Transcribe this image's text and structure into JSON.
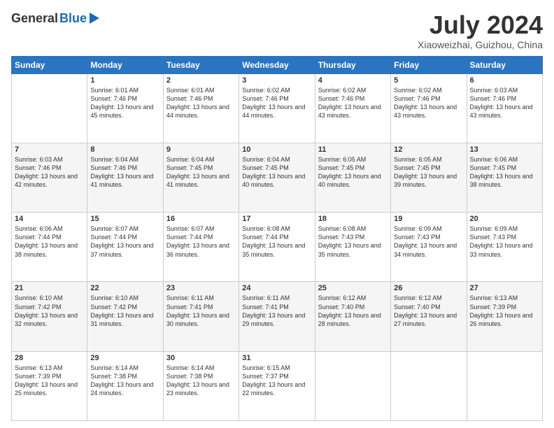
{
  "header": {
    "logo_general": "General",
    "logo_blue": "Blue",
    "month_title": "July 2024",
    "location": "Xiaoweizhai, Guizhou, China"
  },
  "calendar": {
    "headers": [
      "Sunday",
      "Monday",
      "Tuesday",
      "Wednesday",
      "Thursday",
      "Friday",
      "Saturday"
    ],
    "weeks": [
      [
        {
          "day": "",
          "sunrise": "",
          "sunset": "",
          "daylight": ""
        },
        {
          "day": "1",
          "sunrise": "Sunrise: 6:01 AM",
          "sunset": "Sunset: 7:46 PM",
          "daylight": "Daylight: 13 hours and 45 minutes."
        },
        {
          "day": "2",
          "sunrise": "Sunrise: 6:01 AM",
          "sunset": "Sunset: 7:46 PM",
          "daylight": "Daylight: 13 hours and 44 minutes."
        },
        {
          "day": "3",
          "sunrise": "Sunrise: 6:02 AM",
          "sunset": "Sunset: 7:46 PM",
          "daylight": "Daylight: 13 hours and 44 minutes."
        },
        {
          "day": "4",
          "sunrise": "Sunrise: 6:02 AM",
          "sunset": "Sunset: 7:46 PM",
          "daylight": "Daylight: 13 hours and 43 minutes."
        },
        {
          "day": "5",
          "sunrise": "Sunrise: 6:02 AM",
          "sunset": "Sunset: 7:46 PM",
          "daylight": "Daylight: 13 hours and 43 minutes."
        },
        {
          "day": "6",
          "sunrise": "Sunrise: 6:03 AM",
          "sunset": "Sunset: 7:46 PM",
          "daylight": "Daylight: 13 hours and 43 minutes."
        }
      ],
      [
        {
          "day": "7",
          "sunrise": "Sunrise: 6:03 AM",
          "sunset": "Sunset: 7:46 PM",
          "daylight": "Daylight: 13 hours and 42 minutes."
        },
        {
          "day": "8",
          "sunrise": "Sunrise: 6:04 AM",
          "sunset": "Sunset: 7:46 PM",
          "daylight": "Daylight: 13 hours and 41 minutes."
        },
        {
          "day": "9",
          "sunrise": "Sunrise: 6:04 AM",
          "sunset": "Sunset: 7:45 PM",
          "daylight": "Daylight: 13 hours and 41 minutes."
        },
        {
          "day": "10",
          "sunrise": "Sunrise: 6:04 AM",
          "sunset": "Sunset: 7:45 PM",
          "daylight": "Daylight: 13 hours and 40 minutes."
        },
        {
          "day": "11",
          "sunrise": "Sunrise: 6:05 AM",
          "sunset": "Sunset: 7:45 PM",
          "daylight": "Daylight: 13 hours and 40 minutes."
        },
        {
          "day": "12",
          "sunrise": "Sunrise: 6:05 AM",
          "sunset": "Sunset: 7:45 PM",
          "daylight": "Daylight: 13 hours and 39 minutes."
        },
        {
          "day": "13",
          "sunrise": "Sunrise: 6:06 AM",
          "sunset": "Sunset: 7:45 PM",
          "daylight": "Daylight: 13 hours and 38 minutes."
        }
      ],
      [
        {
          "day": "14",
          "sunrise": "Sunrise: 6:06 AM",
          "sunset": "Sunset: 7:44 PM",
          "daylight": "Daylight: 13 hours and 38 minutes."
        },
        {
          "day": "15",
          "sunrise": "Sunrise: 6:07 AM",
          "sunset": "Sunset: 7:44 PM",
          "daylight": "Daylight: 13 hours and 37 minutes."
        },
        {
          "day": "16",
          "sunrise": "Sunrise: 6:07 AM",
          "sunset": "Sunset: 7:44 PM",
          "daylight": "Daylight: 13 hours and 36 minutes."
        },
        {
          "day": "17",
          "sunrise": "Sunrise: 6:08 AM",
          "sunset": "Sunset: 7:44 PM",
          "daylight": "Daylight: 13 hours and 35 minutes."
        },
        {
          "day": "18",
          "sunrise": "Sunrise: 6:08 AM",
          "sunset": "Sunset: 7:43 PM",
          "daylight": "Daylight: 13 hours and 35 minutes."
        },
        {
          "day": "19",
          "sunrise": "Sunrise: 6:09 AM",
          "sunset": "Sunset: 7:43 PM",
          "daylight": "Daylight: 13 hours and 34 minutes."
        },
        {
          "day": "20",
          "sunrise": "Sunrise: 6:09 AM",
          "sunset": "Sunset: 7:43 PM",
          "daylight": "Daylight: 13 hours and 33 minutes."
        }
      ],
      [
        {
          "day": "21",
          "sunrise": "Sunrise: 6:10 AM",
          "sunset": "Sunset: 7:42 PM",
          "daylight": "Daylight: 13 hours and 32 minutes."
        },
        {
          "day": "22",
          "sunrise": "Sunrise: 6:10 AM",
          "sunset": "Sunset: 7:42 PM",
          "daylight": "Daylight: 13 hours and 31 minutes."
        },
        {
          "day": "23",
          "sunrise": "Sunrise: 6:11 AM",
          "sunset": "Sunset: 7:41 PM",
          "daylight": "Daylight: 13 hours and 30 minutes."
        },
        {
          "day": "24",
          "sunrise": "Sunrise: 6:11 AM",
          "sunset": "Sunset: 7:41 PM",
          "daylight": "Daylight: 13 hours and 29 minutes."
        },
        {
          "day": "25",
          "sunrise": "Sunrise: 6:12 AM",
          "sunset": "Sunset: 7:40 PM",
          "daylight": "Daylight: 13 hours and 28 minutes."
        },
        {
          "day": "26",
          "sunrise": "Sunrise: 6:12 AM",
          "sunset": "Sunset: 7:40 PM",
          "daylight": "Daylight: 13 hours and 27 minutes."
        },
        {
          "day": "27",
          "sunrise": "Sunrise: 6:13 AM",
          "sunset": "Sunset: 7:39 PM",
          "daylight": "Daylight: 13 hours and 26 minutes."
        }
      ],
      [
        {
          "day": "28",
          "sunrise": "Sunrise: 6:13 AM",
          "sunset": "Sunset: 7:39 PM",
          "daylight": "Daylight: 13 hours and 25 minutes."
        },
        {
          "day": "29",
          "sunrise": "Sunrise: 6:14 AM",
          "sunset": "Sunset: 7:38 PM",
          "daylight": "Daylight: 13 hours and 24 minutes."
        },
        {
          "day": "30",
          "sunrise": "Sunrise: 6:14 AM",
          "sunset": "Sunset: 7:38 PM",
          "daylight": "Daylight: 13 hours and 23 minutes."
        },
        {
          "day": "31",
          "sunrise": "Sunrise: 6:15 AM",
          "sunset": "Sunset: 7:37 PM",
          "daylight": "Daylight: 13 hours and 22 minutes."
        },
        {
          "day": "",
          "sunrise": "",
          "sunset": "",
          "daylight": ""
        },
        {
          "day": "",
          "sunrise": "",
          "sunset": "",
          "daylight": ""
        },
        {
          "day": "",
          "sunrise": "",
          "sunset": "",
          "daylight": ""
        }
      ]
    ]
  }
}
